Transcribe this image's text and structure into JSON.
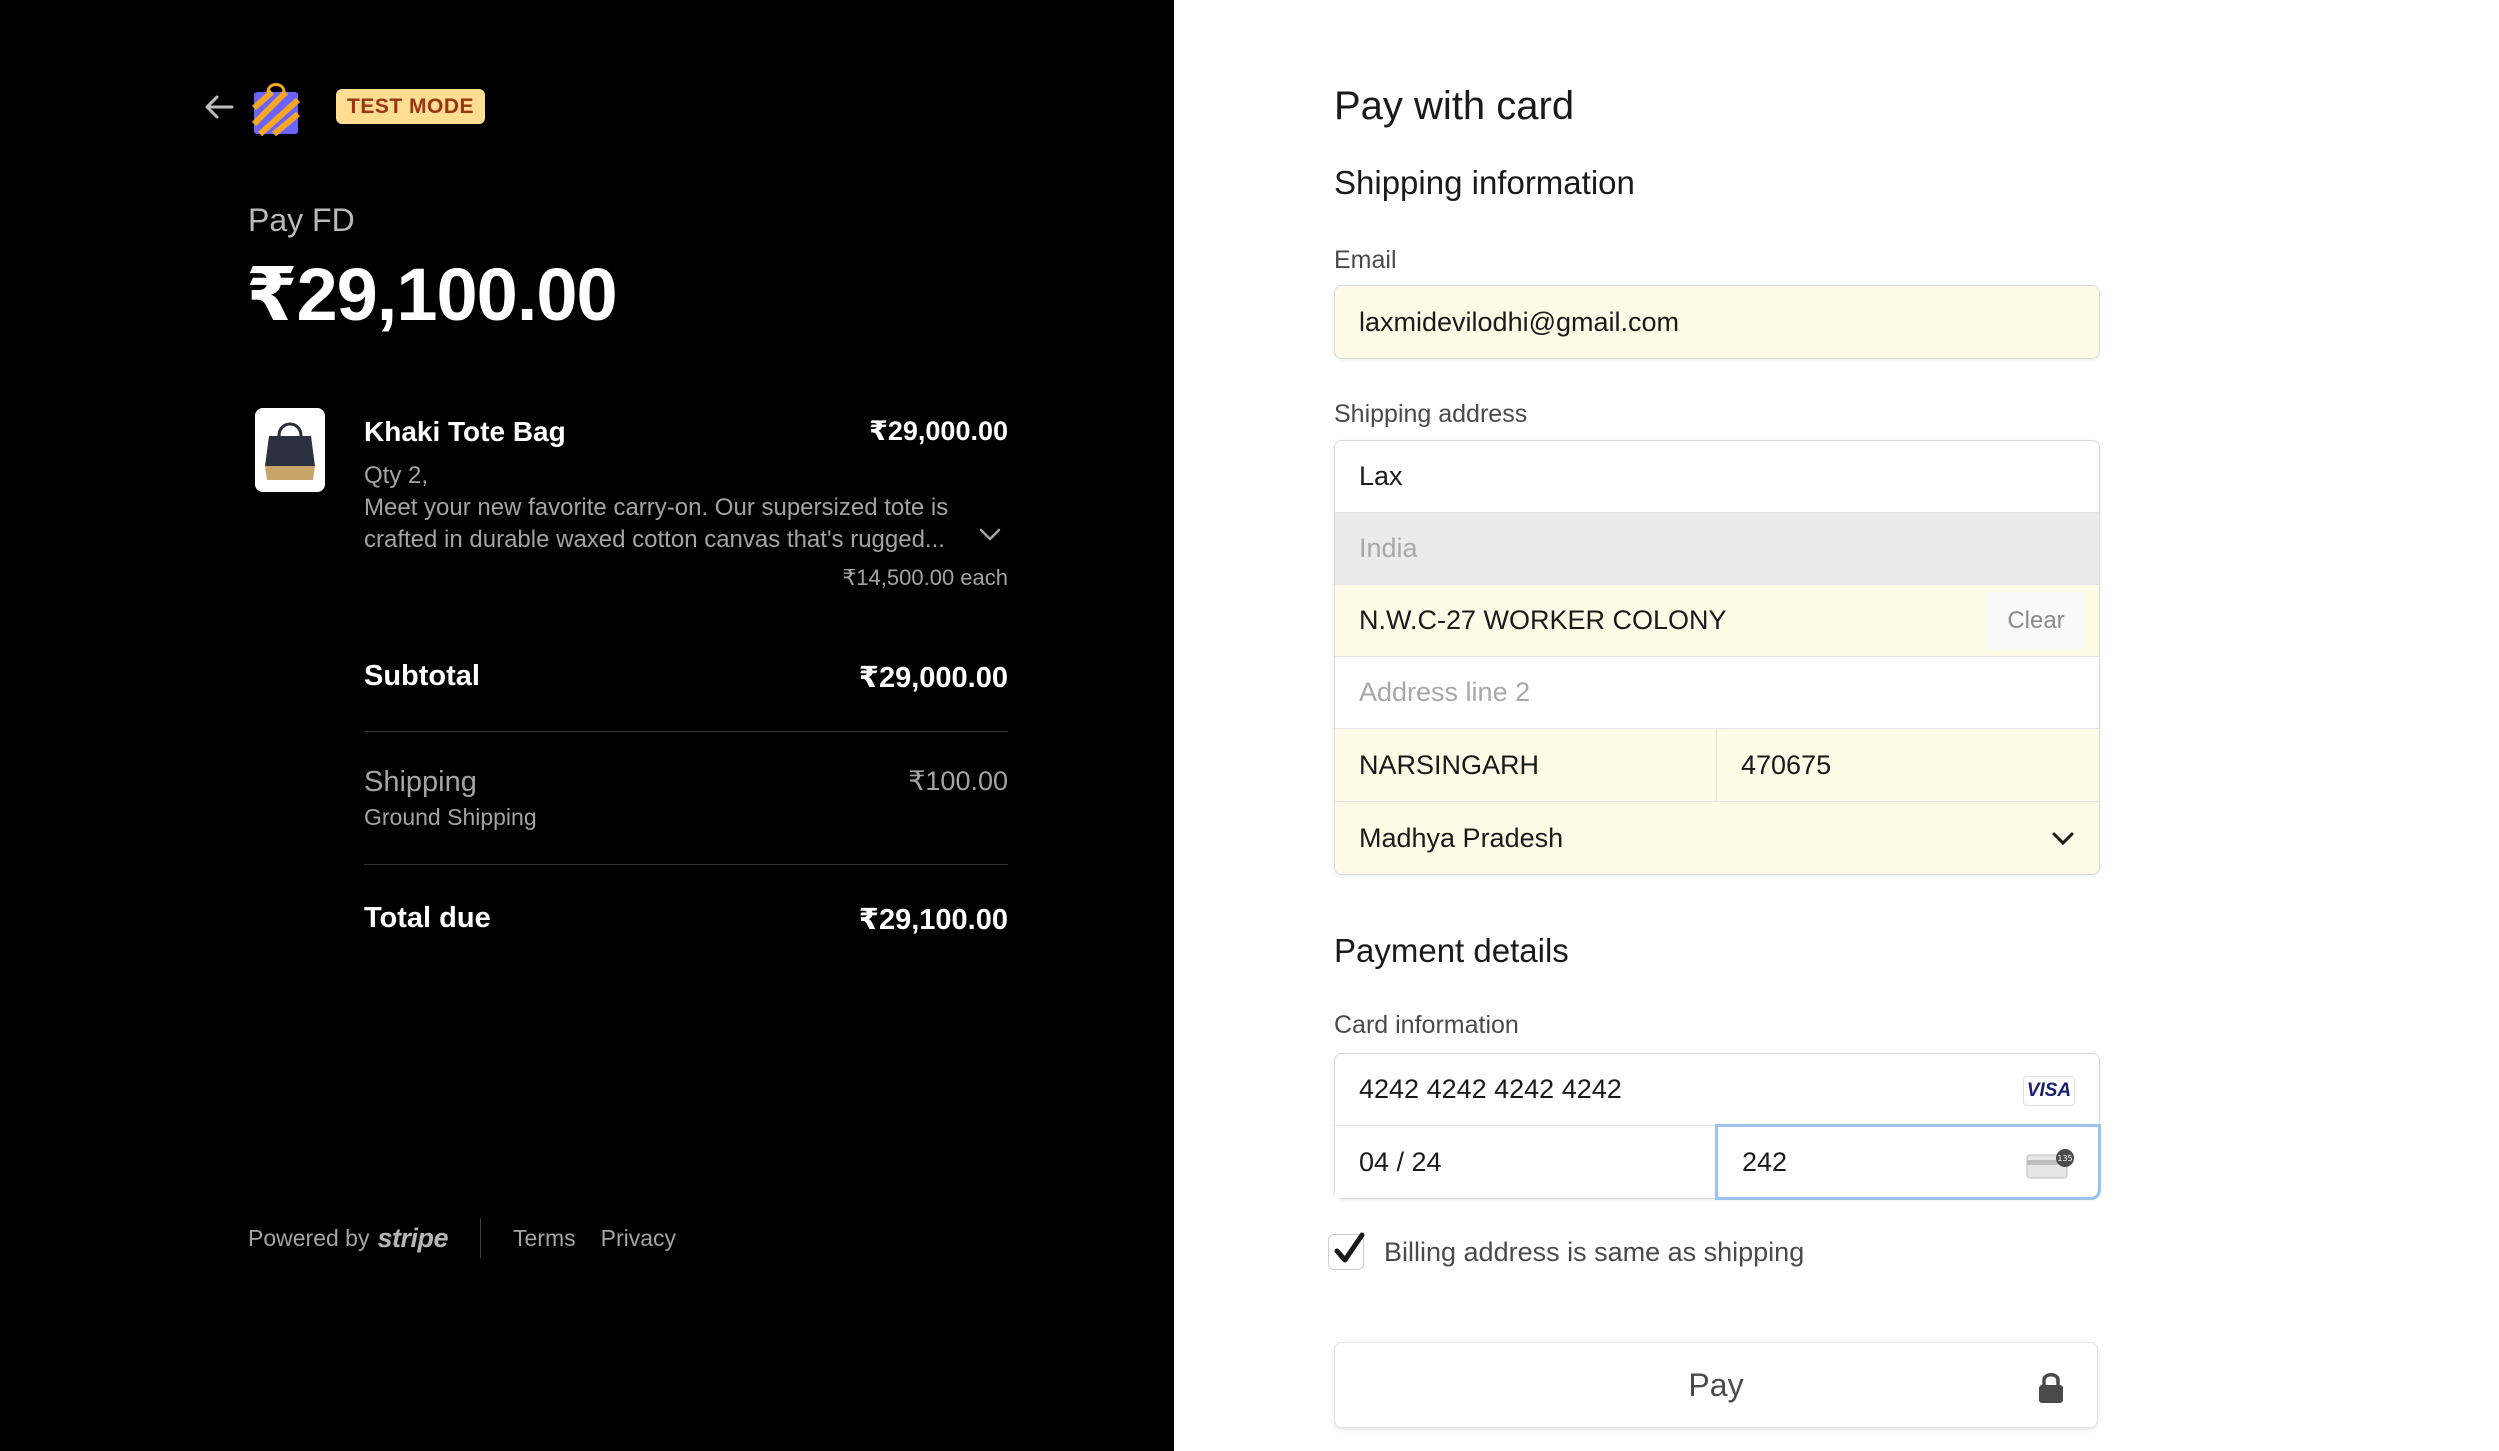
{
  "summary": {
    "badge": "TEST MODE",
    "merchant": "Pay FD",
    "amount": "₹29,100.00",
    "item": {
      "name": "Khaki Tote Bag",
      "price": "₹29,000.00",
      "qty": "Qty 2,",
      "description": "Meet your new favorite carry-on. Our supersized tote is crafted in durable waxed cotton canvas that's rugged...",
      "each": "₹14,500.00 each"
    },
    "subtotal_label": "Subtotal",
    "subtotal_value": "₹29,000.00",
    "shipping_label": "Shipping",
    "shipping_value": "₹100.00",
    "shipping_method": "Ground Shipping",
    "total_label": "Total due",
    "total_value": "₹29,100.00"
  },
  "footer": {
    "powered_by": "Powered by",
    "brand": "stripe",
    "terms": "Terms",
    "privacy": "Privacy"
  },
  "form": {
    "title": "Pay with card",
    "shipping_heading": "Shipping information",
    "email_label": "Email",
    "email_value": "laxmidevilodhi@gmail.com",
    "address_label": "Shipping address",
    "name_value": "Lax",
    "country_value": "India",
    "line1_value": "N.W.C-27 WORKER COLONY",
    "clear_label": "Clear",
    "line2_placeholder": "Address line 2",
    "city_value": "NARSINGARH",
    "pin_value": "470675",
    "state_value": "Madhya Pradesh",
    "payment_heading": "Payment details",
    "card_label": "Card information",
    "card_number": "4242 4242 4242 4242",
    "card_brand": "VISA",
    "expiry": "04 / 24",
    "cvc": "242",
    "billing_same_label": "Billing address is same as shipping",
    "billing_same_checked": true,
    "pay_label": "Pay"
  },
  "colors": {
    "badge_bg": "#ffde92",
    "autofill_bg": "#fffbe6",
    "focus_outline": "#9dc2f0"
  },
  "icons": [
    "back-arrow-icon",
    "shopping-bag-icon",
    "chevron-down-icon",
    "visa-icon",
    "cvc-card-icon",
    "checkmark-icon",
    "lock-icon"
  ]
}
